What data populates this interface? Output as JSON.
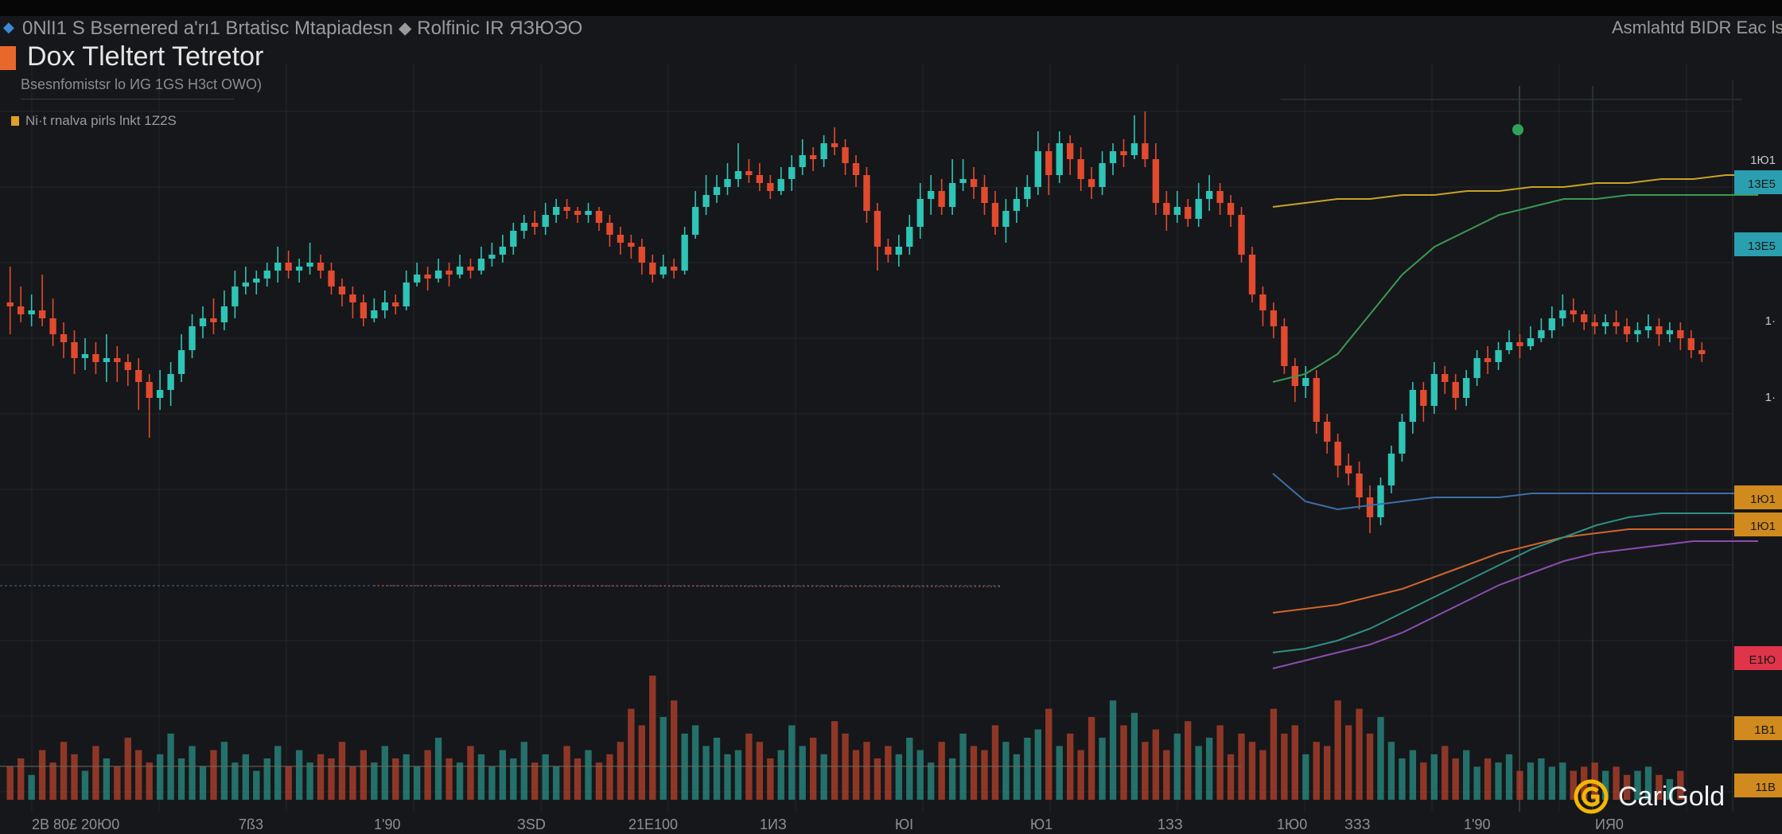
{
  "header": {
    "instrument_line": "0NlI1 S Bsernered a'rı1 Brtatisc  Mtapiadesn  ⬥ Rolfinic IR ЯЗЮЭО",
    "title": "Dox Tleltert Tetretor",
    "subtitle": "Bsesnfomistsr lo ИG 1GS H3ct OWO)",
    "legend_label": "Ni·t rnalva pirls lnkt 1Z2S",
    "right_label": "Asmlahtd BIDR Eac lsa"
  },
  "brand": {
    "name": "CariGold",
    "icon": "gold-coin-logo-icon"
  },
  "colors": {
    "background": "#16171a",
    "up": "#2ec4b6",
    "down": "#e24a2e",
    "ma_yellow": "#c9a227",
    "ma_green": "#3a9a55",
    "ma_blue": "#3d6fa8",
    "ma_orange": "#d0662e",
    "ma_purple": "#8b4db0",
    "ma_teal": "#2f8f86"
  },
  "chart_data": {
    "type": "candlestick",
    "title": "Dox Tleltert Tetretor",
    "subtitle": "Bsesnfomistsr lo ИG 1GS H3ct OWO)",
    "grid": true,
    "x_tick_labels": [
      "2B  80£  20Ю0",
      "7ß3",
      "1'90",
      "ЗSD",
      "21E100",
      "1ИЗ",
      "ЮI",
      "Ю1",
      "1ЗЗ",
      "1Ю0",
      "ЗЗЗ",
      "1'90",
      "ИЯ0"
    ],
    "price_axis_labels": [
      {
        "text": "1Ю1",
        "color": "#c8c8c8",
        "box": false
      },
      {
        "text": "13E5",
        "color": "#2a9fb0",
        "box": true
      },
      {
        "text": "13E5",
        "color": "#2a9fb0",
        "box": true
      },
      {
        "text": "1·",
        "color": "#c8c8c8",
        "box": false
      },
      {
        "text": "1·",
        "color": "#c8c8c8",
        "box": false
      },
      {
        "text": "1Ю1",
        "color": "#d08a1e",
        "box": true
      },
      {
        "text": "1Ю1",
        "color": "#d08a1e",
        "box": true
      },
      {
        "text": "E1Ю",
        "color": "#e0344a",
        "box": true
      },
      {
        "text": "1B1",
        "color": "#d08a1e",
        "box": true
      },
      {
        "text": "11B",
        "color": "#d08a1e",
        "box": true
      }
    ],
    "ylim": [
      0,
      100
    ],
    "candles": [
      [
        48,
        47,
        57,
        40
      ],
      [
        47,
        45,
        52,
        43
      ],
      [
        45,
        46,
        50,
        42
      ],
      [
        46,
        44,
        55,
        42
      ],
      [
        44,
        40,
        49,
        37
      ],
      [
        40,
        38,
        43,
        34
      ],
      [
        38,
        34,
        41,
        30
      ],
      [
        34,
        35,
        39,
        31
      ],
      [
        35,
        33,
        38,
        30
      ],
      [
        33,
        34,
        40,
        28
      ],
      [
        34,
        33,
        37,
        28
      ],
      [
        33,
        31,
        35,
        27
      ],
      [
        31,
        28,
        34,
        21
      ],
      [
        28,
        24,
        30,
        14
      ],
      [
        24,
        26,
        31,
        21
      ],
      [
        26,
        30,
        33,
        22
      ],
      [
        30,
        36,
        40,
        28
      ],
      [
        36,
        42,
        45,
        34
      ],
      [
        42,
        44,
        47,
        39
      ],
      [
        44,
        43,
        49,
        40
      ],
      [
        43,
        47,
        51,
        41
      ],
      [
        47,
        52,
        56,
        44
      ],
      [
        52,
        53,
        57,
        50
      ],
      [
        53,
        54,
        56,
        50
      ],
      [
        54,
        56,
        58,
        52
      ],
      [
        56,
        58,
        62,
        53
      ],
      [
        58,
        56,
        61,
        54
      ],
      [
        56,
        57,
        59,
        53
      ],
      [
        57,
        58,
        63,
        55
      ],
      [
        58,
        56,
        60,
        54
      ],
      [
        56,
        52,
        58,
        50
      ],
      [
        52,
        50,
        54,
        47
      ],
      [
        50,
        48,
        52,
        44
      ],
      [
        48,
        44,
        50,
        42
      ],
      [
        44,
        46,
        49,
        43
      ],
      [
        46,
        48,
        51,
        44
      ],
      [
        48,
        47,
        50,
        45
      ],
      [
        47,
        53,
        56,
        46
      ],
      [
        53,
        55,
        58,
        52
      ],
      [
        55,
        54,
        57,
        51
      ],
      [
        54,
        56,
        59,
        53
      ],
      [
        56,
        55,
        58,
        52
      ],
      [
        55,
        57,
        60,
        54
      ],
      [
        57,
        56,
        59,
        54
      ],
      [
        56,
        59,
        62,
        55
      ],
      [
        59,
        60,
        63,
        57
      ],
      [
        60,
        62,
        65,
        58
      ],
      [
        62,
        66,
        68,
        60
      ],
      [
        66,
        68,
        70,
        64
      ],
      [
        68,
        67,
        71,
        65
      ],
      [
        67,
        70,
        73,
        65
      ],
      [
        70,
        72,
        74,
        68
      ],
      [
        72,
        71,
        74,
        69
      ],
      [
        71,
        70,
        72,
        68
      ],
      [
        70,
        71,
        73,
        68
      ],
      [
        71,
        68,
        72,
        66
      ],
      [
        68,
        65,
        70,
        62
      ],
      [
        65,
        63,
        67,
        60
      ],
      [
        63,
        62,
        65,
        59
      ],
      [
        62,
        58,
        64,
        55
      ],
      [
        58,
        55,
        60,
        53
      ],
      [
        55,
        57,
        60,
        54
      ],
      [
        57,
        56,
        59,
        54
      ],
      [
        56,
        65,
        67,
        55
      ],
      [
        65,
        72,
        76,
        64
      ],
      [
        72,
        75,
        80,
        70
      ],
      [
        75,
        77,
        80,
        73
      ],
      [
        77,
        79,
        83,
        75
      ],
      [
        79,
        81,
        88,
        77
      ],
      [
        81,
        80,
        84,
        78
      ],
      [
        80,
        78,
        83,
        76
      ],
      [
        78,
        76,
        80,
        74
      ],
      [
        76,
        79,
        82,
        75
      ],
      [
        79,
        82,
        85,
        76
      ],
      [
        82,
        85,
        89,
        80
      ],
      [
        85,
        84,
        87,
        81
      ],
      [
        84,
        88,
        90,
        82
      ],
      [
        88,
        87,
        92,
        85
      ],
      [
        87,
        83,
        89,
        80
      ],
      [
        83,
        80,
        85,
        77
      ],
      [
        80,
        71,
        82,
        68
      ],
      [
        71,
        62,
        73,
        56
      ],
      [
        62,
        60,
        64,
        58
      ],
      [
        60,
        62,
        65,
        57
      ],
      [
        62,
        67,
        70,
        60
      ],
      [
        67,
        74,
        78,
        64
      ],
      [
        74,
        76,
        80,
        70
      ],
      [
        76,
        72,
        79,
        70
      ],
      [
        72,
        78,
        84,
        70
      ],
      [
        78,
        79,
        84,
        76
      ],
      [
        79,
        77,
        82,
        74
      ],
      [
        77,
        73,
        80,
        70
      ],
      [
        73,
        67,
        76,
        65
      ],
      [
        67,
        71,
        74,
        63
      ],
      [
        71,
        74,
        77,
        68
      ],
      [
        74,
        77,
        80,
        72
      ],
      [
        77,
        86,
        91,
        75
      ],
      [
        86,
        80,
        88,
        75
      ],
      [
        80,
        88,
        91,
        78
      ],
      [
        88,
        84,
        90,
        80
      ],
      [
        84,
        79,
        87,
        76
      ],
      [
        79,
        77,
        82,
        74
      ],
      [
        77,
        83,
        86,
        75
      ],
      [
        83,
        86,
        88,
        80
      ],
      [
        86,
        85,
        89,
        82
      ],
      [
        85,
        88,
        95,
        84
      ],
      [
        88,
        84,
        96,
        82
      ],
      [
        84,
        73,
        88,
        70
      ],
      [
        73,
        70,
        76,
        66
      ],
      [
        70,
        72,
        76,
        68
      ],
      [
        72,
        69,
        74,
        67
      ],
      [
        69,
        74,
        78,
        67
      ],
      [
        74,
        76,
        80,
        71
      ],
      [
        76,
        73,
        78,
        70
      ],
      [
        73,
        70,
        75,
        67
      ],
      [
        70,
        60,
        72,
        58
      ],
      [
        60,
        50,
        62,
        48
      ],
      [
        50,
        46,
        52,
        42
      ],
      [
        46,
        42,
        48,
        39
      ],
      [
        42,
        32,
        44,
        30
      ],
      [
        32,
        27,
        34,
        23
      ],
      [
        27,
        29,
        32,
        24
      ],
      [
        29,
        18,
        31,
        15
      ],
      [
        18,
        13,
        20,
        10
      ],
      [
        13,
        7,
        15,
        4
      ],
      [
        7,
        5,
        10,
        2
      ],
      [
        5,
        -1,
        8,
        -4
      ],
      [
        -1,
        -6,
        2,
        -10
      ],
      [
        -6,
        2,
        4,
        -8
      ],
      [
        2,
        10,
        12,
        0
      ],
      [
        10,
        18,
        20,
        8
      ],
      [
        18,
        26,
        28,
        15
      ],
      [
        26,
        22,
        28,
        18
      ],
      [
        22,
        30,
        33,
        20
      ],
      [
        30,
        28,
        32,
        25
      ],
      [
        28,
        24,
        30,
        21
      ],
      [
        24,
        29,
        31,
        22
      ],
      [
        29,
        34,
        36,
        27
      ],
      [
        34,
        33,
        37,
        30
      ],
      [
        33,
        36,
        38,
        31
      ],
      [
        36,
        38,
        41,
        35
      ],
      [
        38,
        37,
        40,
        34
      ],
      [
        37,
        39,
        42,
        36
      ],
      [
        39,
        41,
        44,
        38
      ],
      [
        41,
        44,
        47,
        39
      ],
      [
        44,
        46,
        50,
        42
      ],
      [
        46,
        45,
        49,
        43
      ],
      [
        45,
        43,
        46,
        41
      ],
      [
        43,
        42,
        45,
        40
      ],
      [
        42,
        43,
        45,
        40
      ],
      [
        43,
        42,
        46,
        40
      ],
      [
        42,
        40,
        44,
        38
      ],
      [
        40,
        41,
        43,
        38
      ],
      [
        41,
        42,
        45,
        39
      ],
      [
        42,
        40,
        44,
        37
      ],
      [
        40,
        41,
        43,
        38
      ],
      [
        41,
        39,
        43,
        36
      ],
      [
        39,
        36,
        41,
        34
      ],
      [
        36,
        35,
        38,
        33
      ]
    ],
    "volume": [
      8,
      10,
      6,
      12,
      9,
      14,
      11,
      7,
      13,
      10,
      8,
      15,
      12,
      9,
      11,
      16,
      10,
      13,
      8,
      12,
      14,
      9,
      11,
      7,
      10,
      13,
      8,
      12,
      9,
      11,
      10,
      14,
      8,
      12,
      9,
      13,
      10,
      11,
      8,
      12,
      15,
      10,
      9,
      13,
      11,
      8,
      12,
      10,
      14,
      9,
      11,
      8,
      13,
      10,
      12,
      9,
      11,
      14,
      22,
      18,
      30,
      20,
      24,
      16,
      18,
      13,
      15,
      11,
      12,
      16,
      14,
      10,
      12,
      18,
      13,
      15,
      11,
      19,
      16,
      12,
      14,
      10,
      13,
      11,
      15,
      12,
      9,
      14,
      10,
      16,
      13,
      12,
      18,
      14,
      11,
      15,
      17,
      22,
      13,
      16,
      12,
      20,
      15,
      24,
      18,
      21,
      14,
      17,
      12,
      16,
      19,
      13,
      15,
      18,
      11,
      16,
      14,
      12,
      22,
      16,
      18,
      11,
      14,
      13,
      24,
      18,
      22,
      16,
      20,
      14,
      10,
      12,
      9,
      11,
      13,
      10,
      12,
      8,
      10,
      9,
      11,
      7,
      9,
      10,
      8,
      9,
      7,
      8,
      9,
      7,
      8,
      6,
      7,
      8,
      6,
      5,
      7
    ],
    "ma_series": [
      {
        "color": "#c9a227",
        "values": [
          72,
          73,
          74,
          74,
          75,
          75,
          76,
          76,
          77,
          77,
          78,
          78,
          79,
          79,
          80,
          80
        ]
      },
      {
        "color": "#3a9a55",
        "values": [
          28,
          30,
          35,
          45,
          55,
          62,
          66,
          70,
          72,
          74,
          74,
          75,
          75,
          75,
          75,
          75
        ]
      },
      {
        "color": "#3d6fa8",
        "values": [
          5,
          -2,
          -4,
          -3,
          -2,
          -1,
          -1,
          -1,
          0,
          0,
          0,
          0,
          0,
          0,
          0,
          0
        ]
      },
      {
        "color": "#d0662e",
        "values": [
          -30,
          -29,
          -28,
          -26,
          -24,
          -21,
          -18,
          -15,
          -13,
          -11,
          -10,
          -9,
          -9,
          -9,
          -9,
          -9
        ]
      },
      {
        "color": "#8b4db0",
        "values": [
          -44,
          -42,
          -40,
          -38,
          -35,
          -31,
          -27,
          -23,
          -20,
          -17,
          -15,
          -14,
          -13,
          -12,
          -12,
          -12
        ]
      },
      {
        "color": "#2f8f86",
        "values": [
          -40,
          -39,
          -37,
          -34,
          -30,
          -26,
          -22,
          -18,
          -14,
          -11,
          -8,
          -6,
          -5,
          -5,
          -5,
          -5
        ]
      }
    ]
  }
}
